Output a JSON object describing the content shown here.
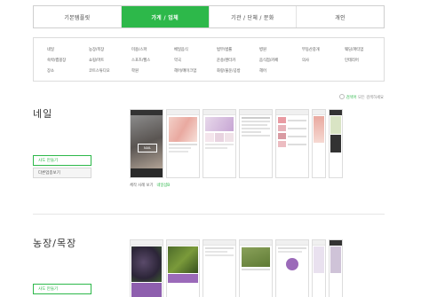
{
  "tabs": [
    {
      "label": "기본템플릿"
    },
    {
      "label": "가게 / 업체"
    },
    {
      "label": "기관 / 단체 / 문화"
    },
    {
      "label": "개인"
    }
  ],
  "categories": [
    {
      "label": "네일"
    },
    {
      "label": "농장/목장"
    },
    {
      "label": "미용/스파"
    },
    {
      "label": "베일음식"
    },
    {
      "label": "법무/법률"
    },
    {
      "label": "병원"
    },
    {
      "label": "부동산중개"
    },
    {
      "label": "웨딩/파티업"
    },
    {
      "label": "숙박/캠핑장"
    },
    {
      "label": "쇼핑/마트"
    },
    {
      "label": "스포츠/헬스"
    },
    {
      "label": "약국"
    },
    {
      "label": "운송/렌터카"
    },
    {
      "label": "음식점/카페"
    },
    {
      "label": "의사"
    },
    {
      "label": "인테리어"
    },
    {
      "label": "장소"
    },
    {
      "label": "코트스튜디오"
    },
    {
      "label": "학원"
    },
    {
      "label": "헤어/메이크업"
    },
    {
      "label": "화랑/물운/공방"
    },
    {
      "label": "헤어"
    }
  ],
  "sample_link": {
    "highlight": "검색어",
    "text": "모든 검색하세요"
  },
  "sections": [
    {
      "title": "네일",
      "make_button": "사도 만들기",
      "more_button": "다른업종보기",
      "caption": "체작 사례 보기",
      "caption_link": "네일샵B",
      "phones": [
        {
          "header": "네일샵",
          "subtitle": "NAIL"
        },
        {
          "header": "소개"
        },
        {
          "header": "예약안내"
        },
        {
          "header": "네일샵"
        },
        {
          "header": "네일샵"
        },
        {
          "header": "네일"
        },
        {
          "header": "네일"
        }
      ]
    },
    {
      "title": "농장/목장",
      "make_button": "사도 만들기",
      "phones": [
        {
          "header": "홈"
        },
        {
          "header": "소개/포도밭"
        },
        {
          "header": "농장소개"
        },
        {
          "header": "상품"
        },
        {
          "header": "체험"
        },
        {
          "header": "농장"
        },
        {
          "header": "농장"
        }
      ]
    }
  ],
  "colors": {
    "accent": "#2db84a"
  }
}
